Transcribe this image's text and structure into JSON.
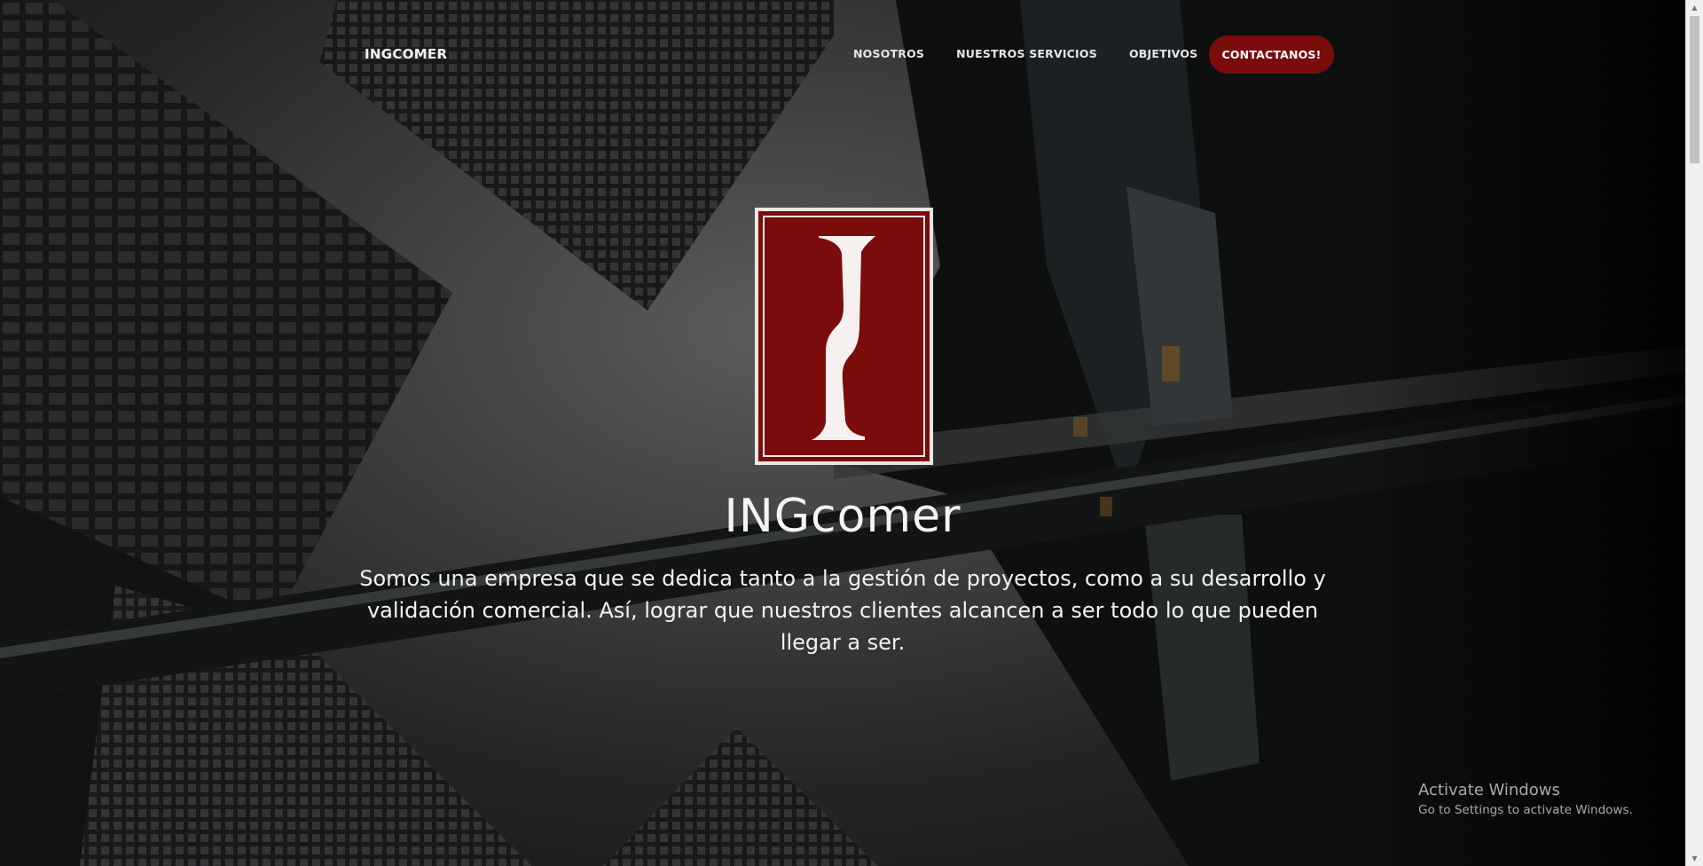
{
  "nav": {
    "brand": "INGCOMER",
    "links": [
      "NOSOTROS",
      "NUESTROS SERVICIOS",
      "OBJETIVOS"
    ],
    "cta": "CONTACTANOS!"
  },
  "hero": {
    "logo_icon": "letter-i-logo",
    "title": "INGcomer",
    "text": "Somos una empresa que se dedica tanto a la gestión de proyectos, como a su desarrollo y validación comercial. Así, lograr que nuestros clientes alcancen a ser todo lo que pueden llegar a ser."
  },
  "os_watermark": {
    "title": "Activate Windows",
    "subtitle": "Go to Settings to activate Windows."
  },
  "colors": {
    "accent": "#7a0c0c",
    "text_light": "#f2f2f2",
    "background_dark": "#1a1a1a"
  }
}
